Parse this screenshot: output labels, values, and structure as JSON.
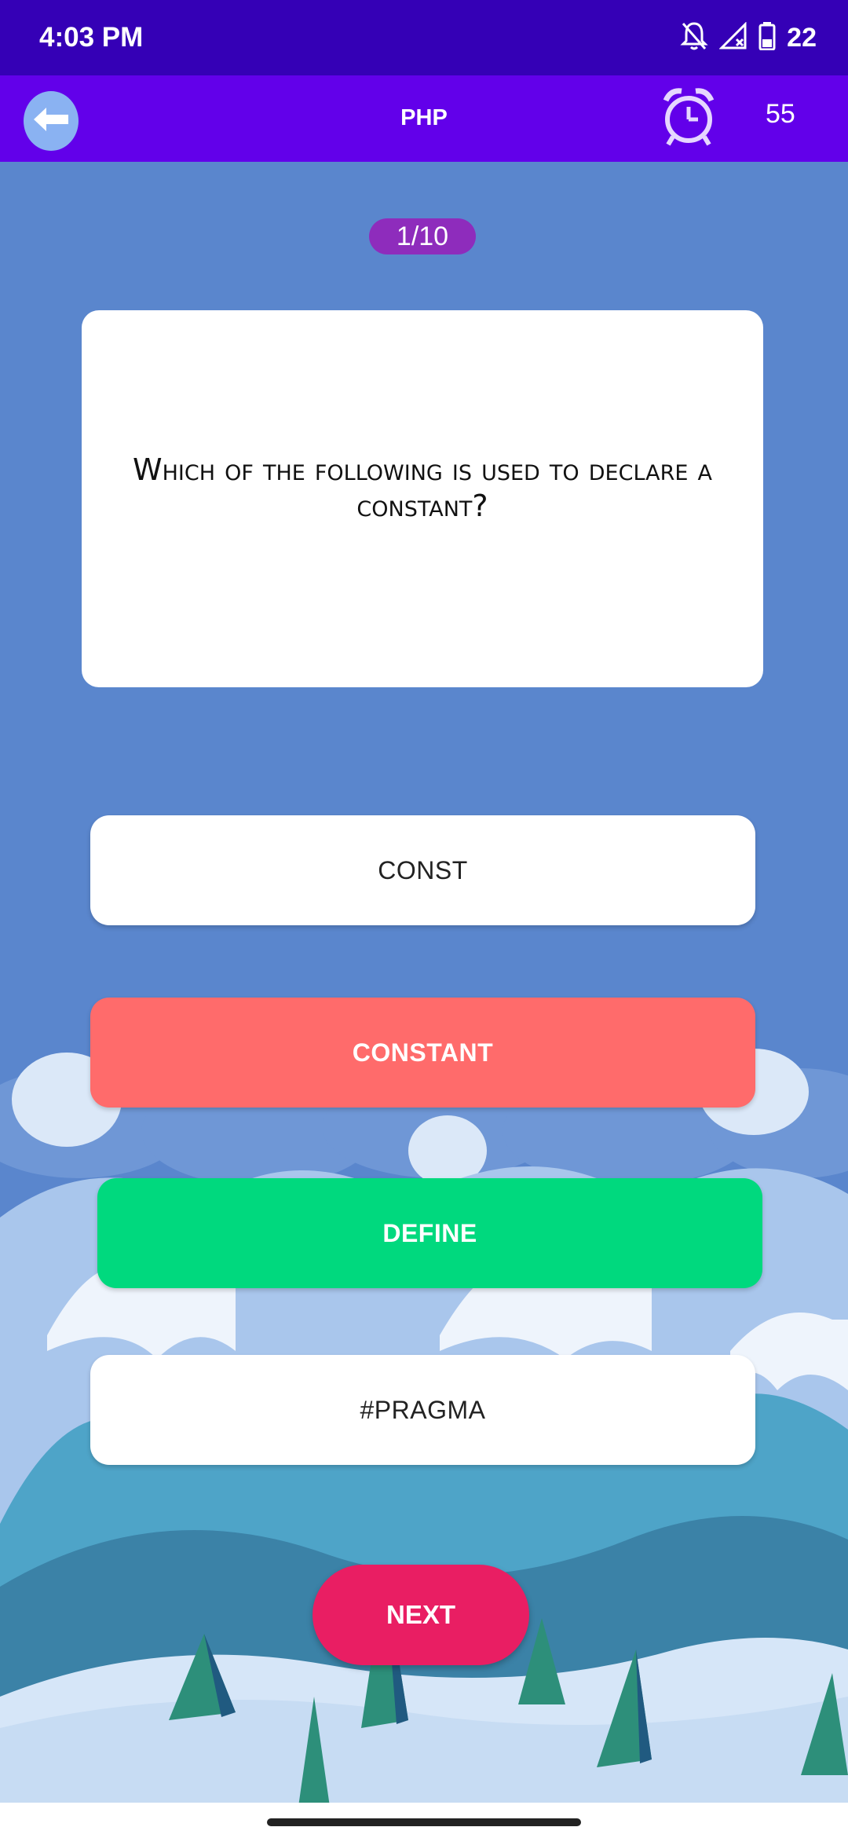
{
  "status_bar": {
    "time": "4:03 PM",
    "battery_level": "22",
    "icons": [
      "notifications-off-icon",
      "signal-icon",
      "battery-icon"
    ]
  },
  "app_bar": {
    "title": "PHP",
    "timer": "55",
    "icons": [
      "back-arrow-icon",
      "alarm-clock-icon"
    ]
  },
  "quiz": {
    "progress": "1/10",
    "question": "Which of the following is used to declare a constant?",
    "options": [
      {
        "label": "CONST",
        "state": "default"
      },
      {
        "label": "CONSTANT",
        "state": "wrong"
      },
      {
        "label": "DEFINE",
        "state": "correct"
      },
      {
        "label": "#PRAGMA",
        "state": "default"
      }
    ],
    "next_label": "NEXT"
  },
  "colors": {
    "status_bar": "#3500b6",
    "app_bar": "#6200ea",
    "background": "#5a86cd",
    "progress_pill": "#8e2cbc",
    "wrong": "#ff6b6b",
    "correct": "#00d97e",
    "next_button": "#e91e63"
  }
}
